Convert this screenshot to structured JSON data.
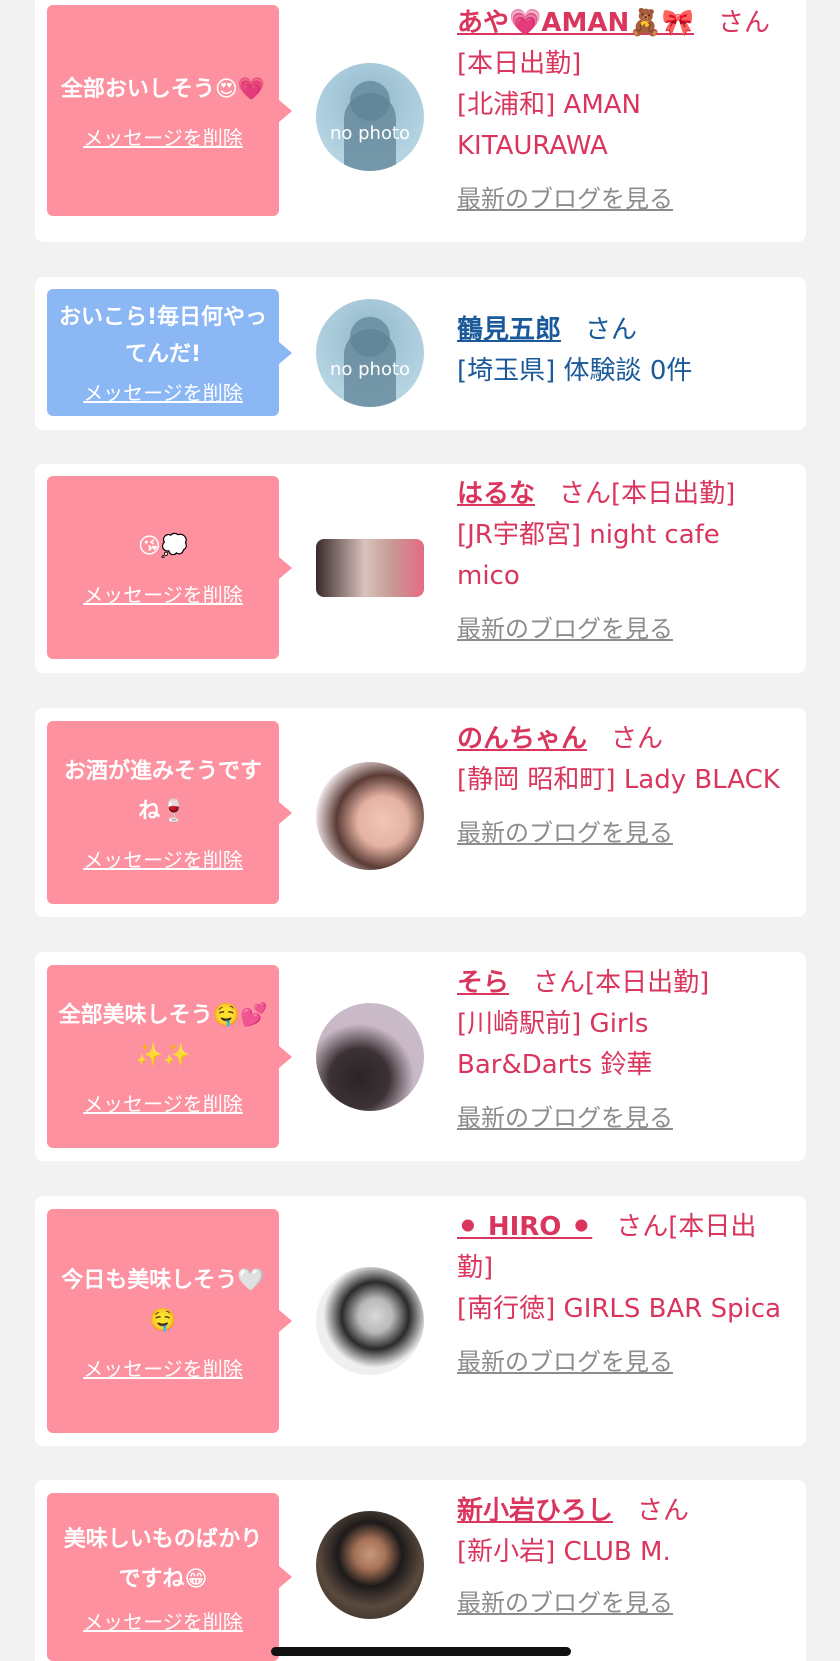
{
  "items": [
    {
      "message": "全部おいしそう😍💗",
      "delete_label": "メッセージを削除",
      "name": "あや💗AMAN🧸🎀",
      "suffix": "さん",
      "status": "[本日出勤]",
      "shop": "[北浦和] AMAN KITAURAWA",
      "blog_label": "最新のブログを見る",
      "avatar": "no photo"
    },
    {
      "message": "おいこら!毎日何やってんだ!",
      "delete_label": "メッセージを削除",
      "name": "鶴見五郎",
      "suffix": "さん",
      "status": "",
      "shop": "[埼玉県] 体験談 0件",
      "avatar": "no photo"
    },
    {
      "message": "😘💭",
      "delete_label": "メッセージを削除",
      "name": "はるな",
      "suffix": "さん",
      "status": "[本日出勤]",
      "shop": "[JR宇都宮] night cafe mico",
      "blog_label": "最新のブログを見る"
    },
    {
      "message": "お酒が進みそうですね🍷",
      "delete_label": "メッセージを削除",
      "name": "のんちゃん",
      "suffix": "さん",
      "status": "",
      "shop": "[静岡 昭和町] Lady BLACK",
      "blog_label": "最新のブログを見る"
    },
    {
      "message": "全部美味しそう🤤💕✨✨",
      "delete_label": "メッセージを削除",
      "name": "そら",
      "suffix": "さん",
      "status": "[本日出勤]",
      "shop": "[川崎駅前] Girls Bar&Darts 鈴華",
      "blog_label": "最新のブログを見る"
    },
    {
      "message": "今日も美味しそう🤍🤤",
      "delete_label": "メッセージを削除",
      "name": "⚫ HIRO ⚫",
      "suffix": "さん",
      "status": "[本日出勤]",
      "shop": "[南行徳] GIRLS BAR Spica",
      "blog_label": "最新のブログを見る"
    },
    {
      "message": "美味しいものばかりですね😁",
      "delete_label": "メッセージを削除",
      "name": "新小岩ひろし",
      "suffix": "さん",
      "status": "",
      "shop": "[新小岩] CLUB M.",
      "blog_label": "最新のブログを見る"
    }
  ],
  "colors": {
    "pink_bubble": "#fd919f",
    "blue_bubble": "#8bb7f5",
    "cast_text": "#d9355d",
    "user_text": "#1a5a9b",
    "blog_link": "#8c8c8c"
  }
}
